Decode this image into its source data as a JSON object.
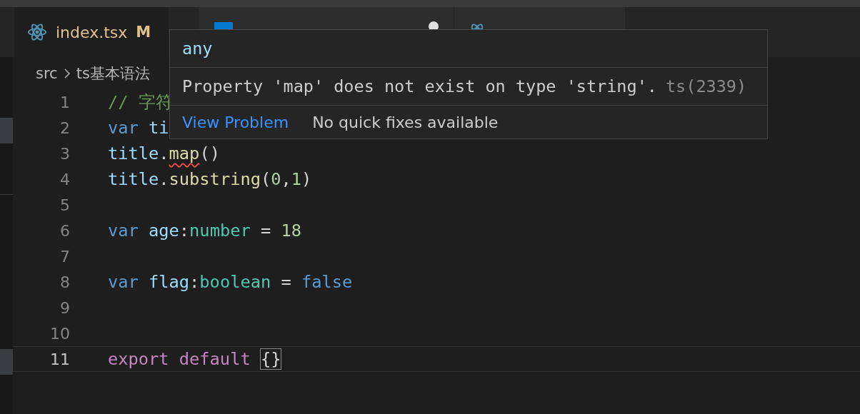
{
  "tabs": [
    {
      "label": "index.tsx",
      "badge": "M",
      "kind": "react",
      "selected": true,
      "dirty": false
    },
    {
      "kind": "ts",
      "selected": false,
      "dirty": true
    },
    {
      "kind": "react",
      "selected": false,
      "dirty": false
    }
  ],
  "breadcrumb": [
    "src",
    "ts基本语法"
  ],
  "lines": [
    {
      "number": "1",
      "current": false,
      "tokens": [
        {
          "t": "// 字符",
          "kind": "comment"
        }
      ]
    },
    {
      "number": "2",
      "current": false,
      "tokens": [
        {
          "t": "var ",
          "kind": "keyword"
        },
        {
          "t": "ti",
          "kind": "variable"
        }
      ]
    },
    {
      "number": "3",
      "current": false,
      "tokens": [
        {
          "t": "title",
          "kind": "variable"
        },
        {
          "t": ".",
          "kind": "punct"
        },
        {
          "t": "map",
          "kind": "method",
          "error": true
        },
        {
          "t": "()",
          "kind": "punct"
        }
      ]
    },
    {
      "number": "4",
      "current": false,
      "tokens": [
        {
          "t": "title",
          "kind": "variable"
        },
        {
          "t": ".",
          "kind": "punct"
        },
        {
          "t": "substring",
          "kind": "method"
        },
        {
          "t": "(",
          "kind": "punct"
        },
        {
          "t": "0",
          "kind": "number"
        },
        {
          "t": ",",
          "kind": "punct"
        },
        {
          "t": "1",
          "kind": "number"
        },
        {
          "t": ")",
          "kind": "punct"
        }
      ]
    },
    {
      "number": "5",
      "current": false
    },
    {
      "number": "6",
      "current": false,
      "tokens": [
        {
          "t": "var ",
          "kind": "keyword"
        },
        {
          "t": "age",
          "kind": "variable"
        },
        {
          "t": ":",
          "kind": "punct"
        },
        {
          "t": "number",
          "kind": "type"
        },
        {
          "t": " = ",
          "kind": "punct"
        },
        {
          "t": "18",
          "kind": "number"
        }
      ]
    },
    {
      "number": "7",
      "current": false
    },
    {
      "number": "8",
      "current": false,
      "tokens": [
        {
          "t": "var ",
          "kind": "keyword"
        },
        {
          "t": "flag",
          "kind": "variable"
        },
        {
          "t": ":",
          "kind": "punct"
        },
        {
          "t": "boolean",
          "kind": "type"
        },
        {
          "t": " = ",
          "kind": "punct"
        },
        {
          "t": "false",
          "kind": "keyword"
        }
      ]
    },
    {
      "number": "9",
      "current": false
    },
    {
      "number": "10",
      "current": false
    },
    {
      "number": "11",
      "current": true,
      "tokens": [
        {
          "t": "export default ",
          "kind": "control"
        },
        {
          "t": "{}",
          "kind": "punct",
          "matched": true
        }
      ]
    }
  ],
  "hover": {
    "type": "any",
    "message": "Property 'map' does not exist on type 'string'.",
    "code": "ts(2339)",
    "action": "View Problem",
    "note": "No quick fixes available"
  }
}
